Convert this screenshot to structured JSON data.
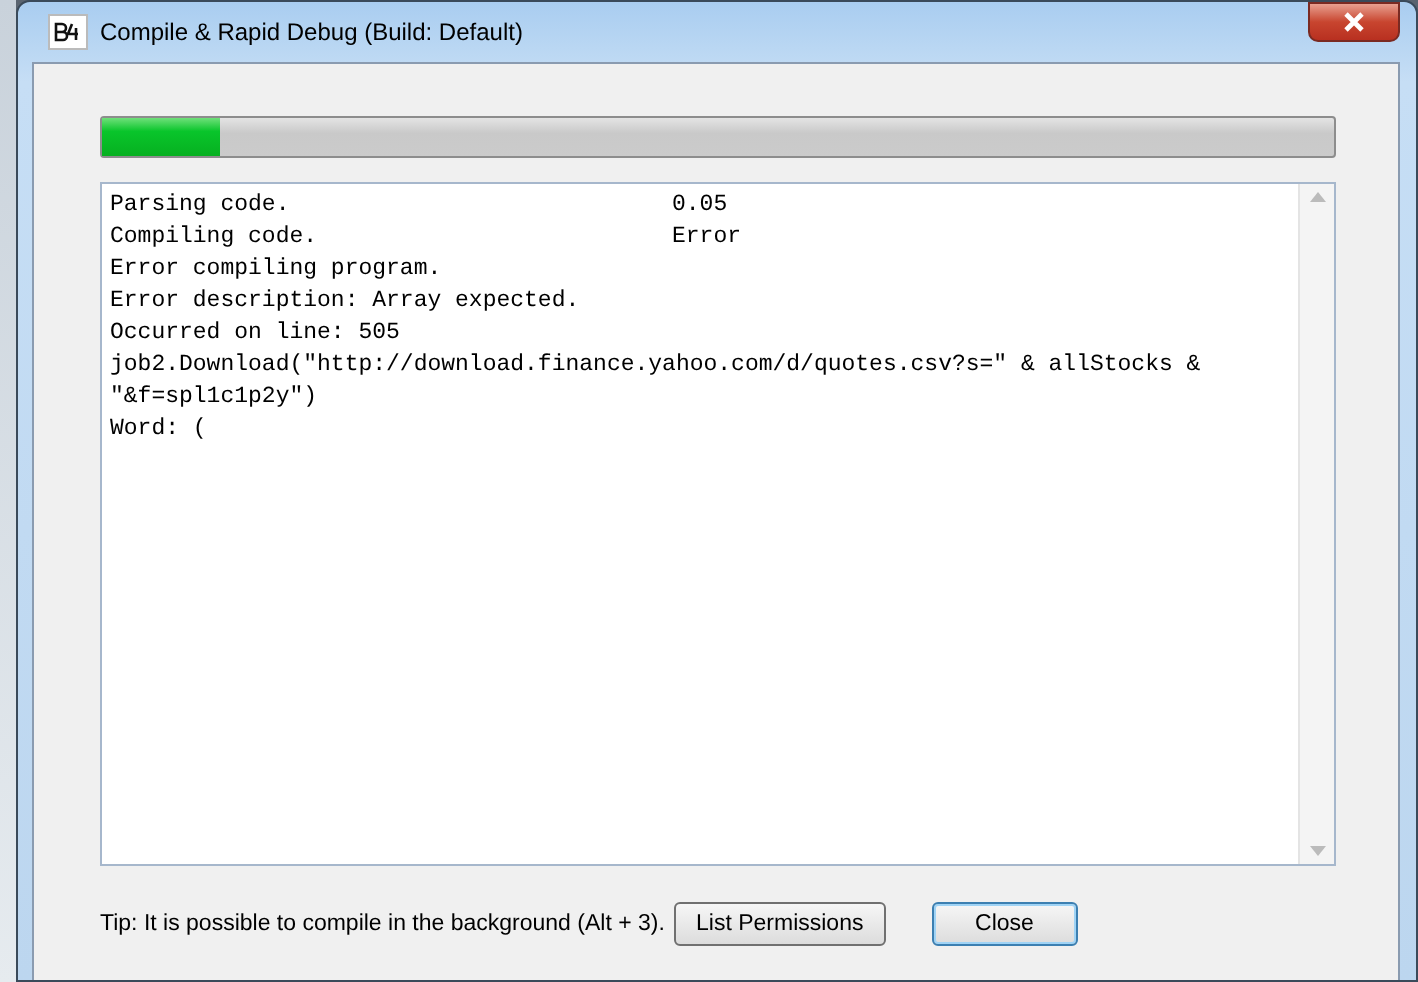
{
  "window": {
    "title": "Compile & Rapid Debug (Build: Default)"
  },
  "progress": {
    "level": 0.095
  },
  "log": [
    {
      "kind": "step",
      "label": "Parsing code.",
      "value": "0.05"
    },
    {
      "kind": "step",
      "label": "Compiling code.",
      "value": "Error"
    },
    {
      "kind": "text",
      "text": "Error compiling program."
    },
    {
      "kind": "text",
      "text": "Error description: Array expected."
    },
    {
      "kind": "text",
      "text": "Occurred on line: 505"
    },
    {
      "kind": "text",
      "text": "job2.Download(\"http://download.finance.yahoo.com/d/quotes.csv?s=\" & allStocks & \"&f=spl1c1p2y\")"
    },
    {
      "kind": "text",
      "text": "Word: ("
    }
  ],
  "tip": "Tip: It is possible to compile in the background (Alt + 3).",
  "buttons": [
    {
      "label": "List Permissions",
      "selected": false
    },
    {
      "label": "Close",
      "selected": true
    }
  ]
}
